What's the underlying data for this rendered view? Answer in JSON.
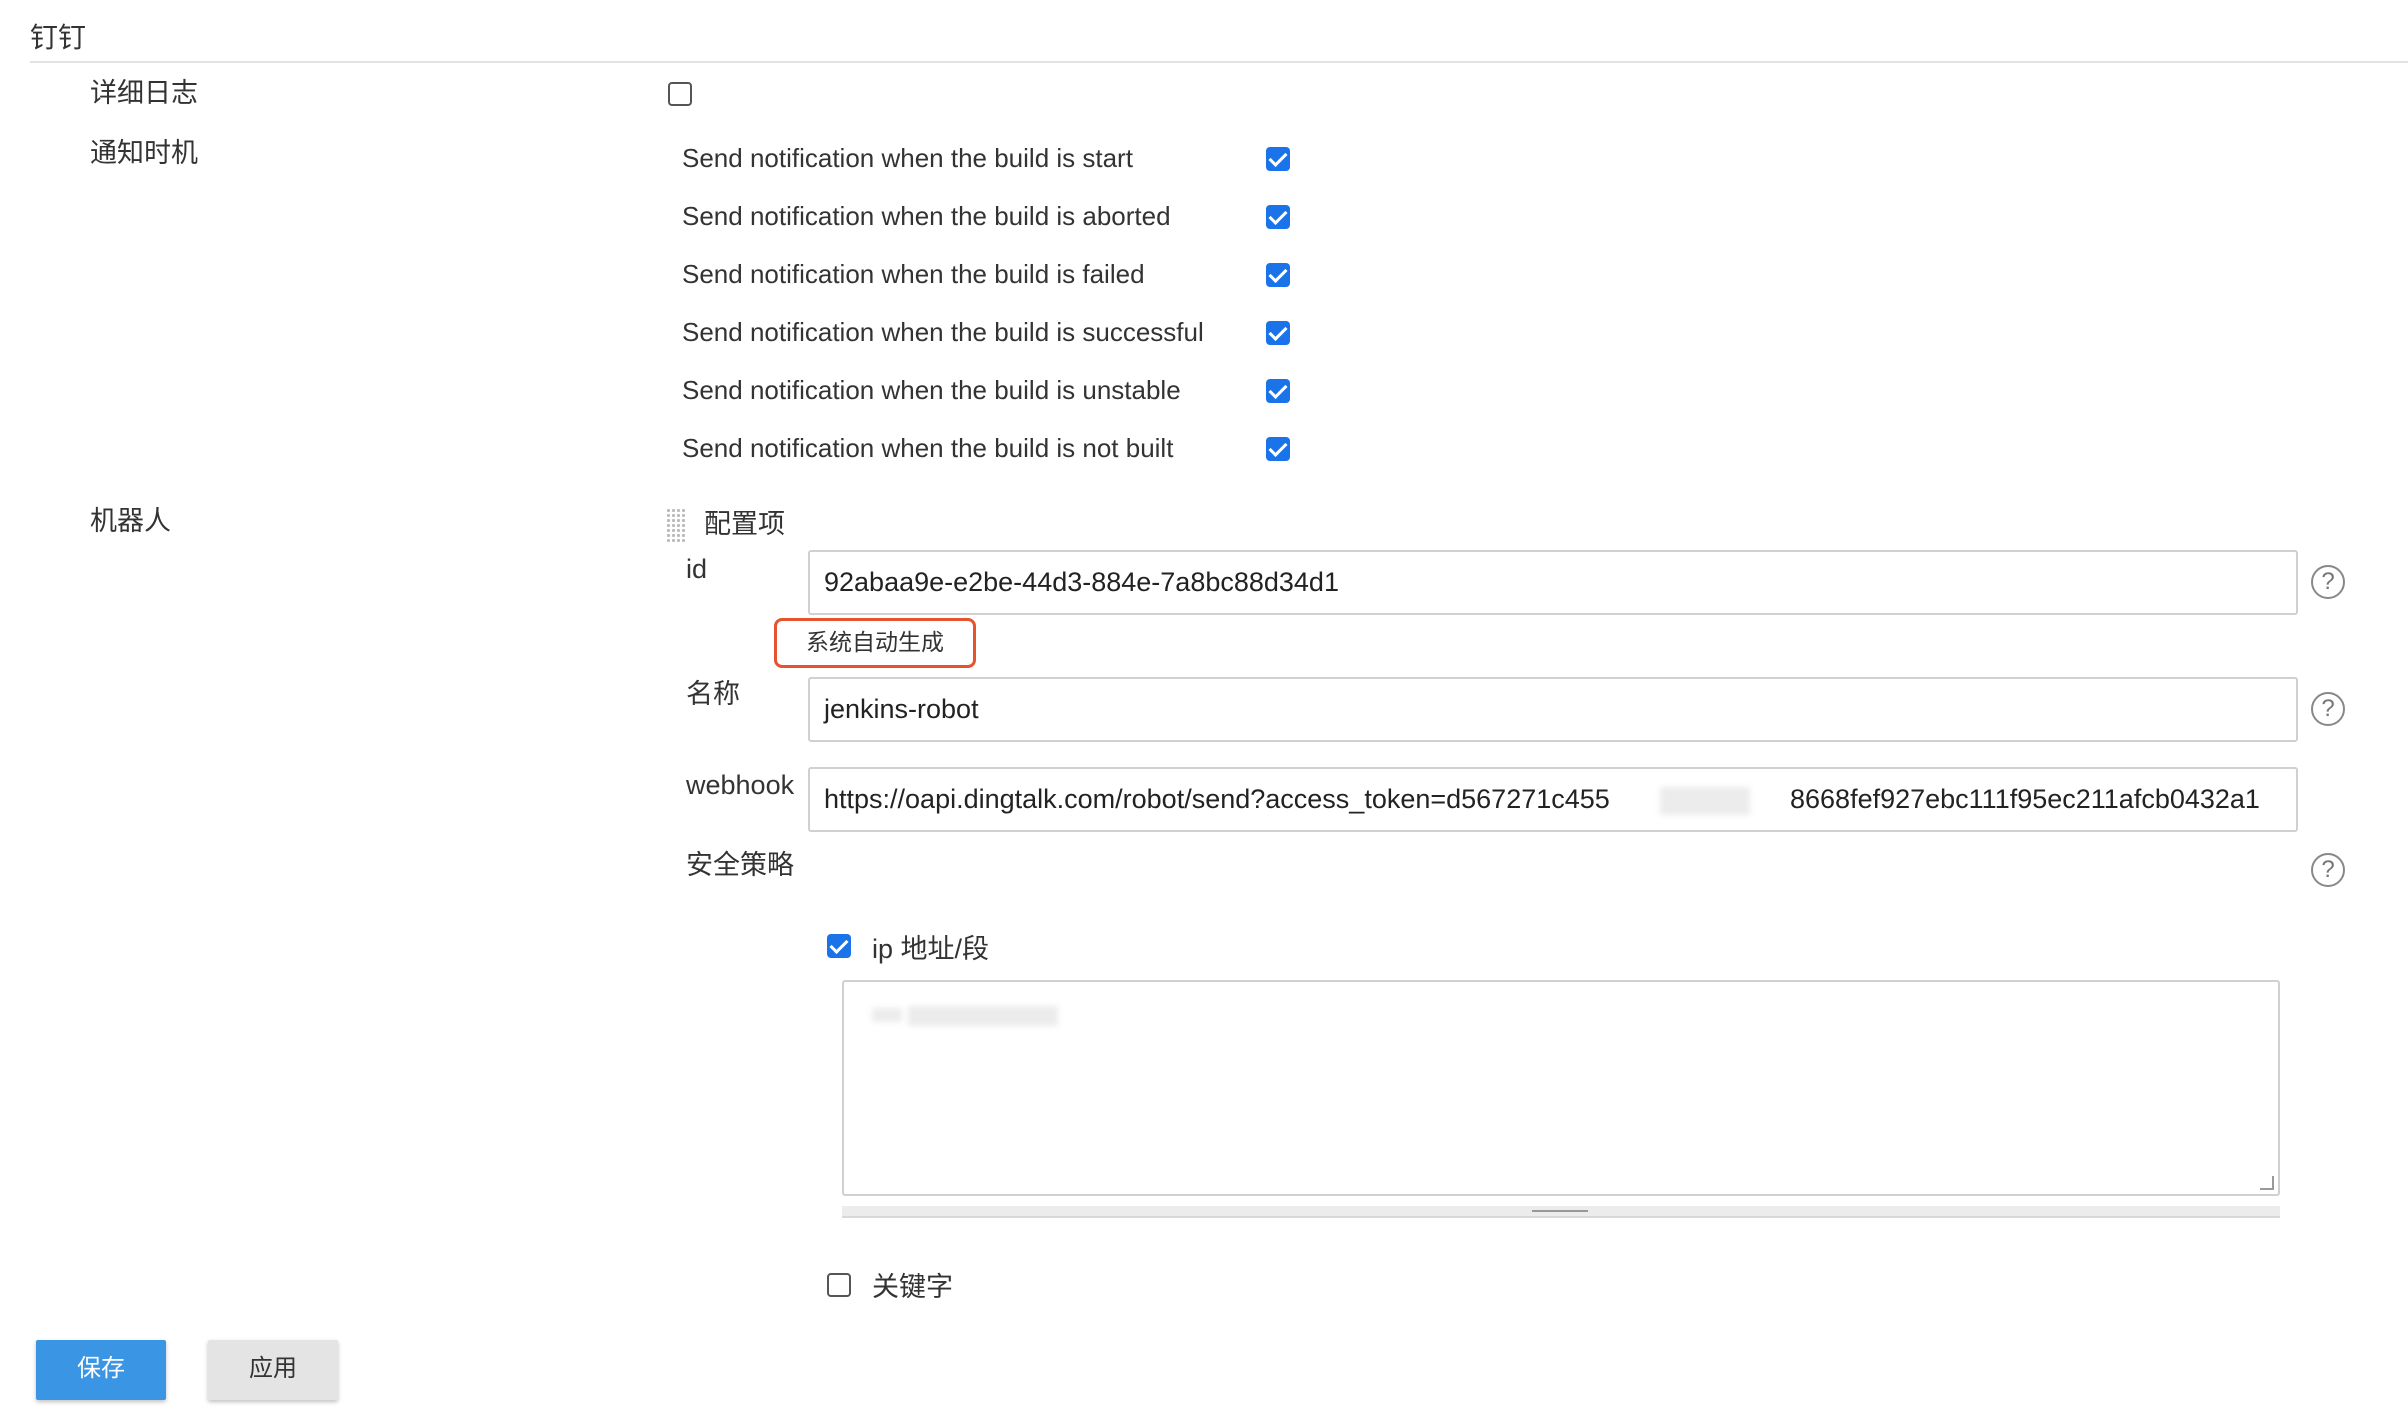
{
  "section": {
    "title": "钉钉"
  },
  "verbose_log": {
    "label": "详细日志",
    "checked": false
  },
  "notify": {
    "label": "通知时机",
    "items": [
      {
        "text": "Send notification when the build is start",
        "checked": true
      },
      {
        "text": "Send notification when the build is aborted",
        "checked": true
      },
      {
        "text": "Send notification when the build is failed",
        "checked": true
      },
      {
        "text": "Send notification when the build is successful",
        "checked": true
      },
      {
        "text": "Send notification when the build is unstable",
        "checked": true
      },
      {
        "text": "Send notification when the build is not built",
        "checked": true
      }
    ]
  },
  "robot": {
    "label": "机器人",
    "config_header": "配置项",
    "id_label": "id",
    "id_value": "92abaa9e-e2be-44d3-884e-7a8bc88d34d1",
    "id_hint": "系统自动生成",
    "name_label": "名称",
    "name_value": "jenkins-robot",
    "webhook_label": "webhook",
    "webhook_value_start": "https://oapi.dingtalk.com/robot/send?access_token=d567271c455",
    "webhook_value_end": "8668fef927ebc111f95ec211afcb0432a1",
    "security_label": "安全策略",
    "ip_option": {
      "label": "ip 地址/段",
      "checked": true
    },
    "keyword_option": {
      "label": "关键字",
      "checked": false
    }
  },
  "buttons": {
    "save": "保存",
    "apply": "应用"
  },
  "icons": {
    "help": "help-icon",
    "drag": "drag-handle-icon"
  },
  "colors": {
    "checkbox": "#1a73e8",
    "primary_button": "#3a95e4",
    "hint_border": "#e5532f"
  }
}
